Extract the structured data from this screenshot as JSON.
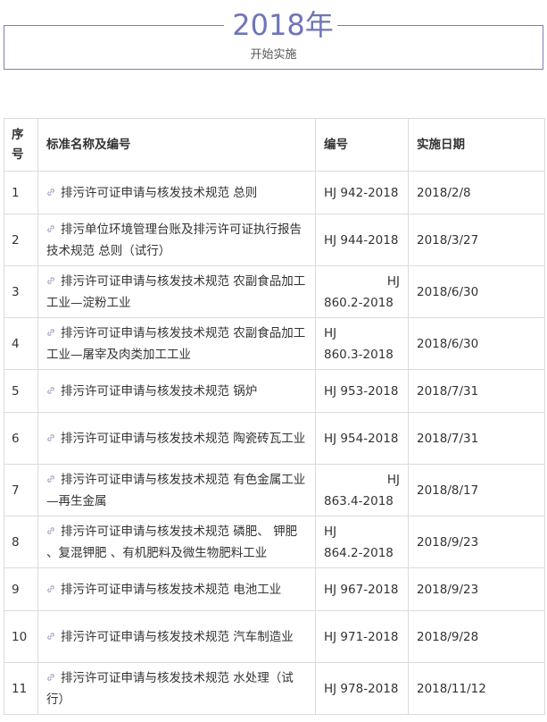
{
  "header": {
    "year": "2018年",
    "subtitle": "开始实施"
  },
  "table": {
    "columns": [
      "序号",
      "标准名称及编号",
      "编号",
      "实施日期"
    ],
    "rows": [
      {
        "idx": "1",
        "name": "排污许可证申请与核发技术规范 总则",
        "code": "HJ 942-2018",
        "date": "2018/2/8"
      },
      {
        "idx": "2",
        "name": "排污单位环境管理台账及排污许可证执行报告技术规范 总则（试行）",
        "code": "HJ 944-2018",
        "date": "2018/3/27"
      },
      {
        "idx": "3",
        "name": "排污许可证申请与核发技术规范 农副食品加工工业—淀粉工业",
        "code": "HJ 860.2-2018",
        "date": "2018/6/30"
      },
      {
        "idx": "4",
        "name": "排污许可证申请与核发技术规范  农副食品加工工业—屠宰及肉类加工工业",
        "code": "HJ 860.3-2018",
        "date": "2018/6/30"
      },
      {
        "idx": "5",
        "name": "排污许可证申请与核发技术规范 锅炉",
        "code": "HJ 953-2018",
        "date": "2018/7/31"
      },
      {
        "idx": "6",
        "name": "排污许可证申请与核发技术规范 陶瓷砖瓦工业",
        "code": "HJ 954-2018",
        "date": "2018/7/31"
      },
      {
        "idx": "7",
        "name": "排污许可证申请与核发技术规范 有色金属工业—再生金属",
        "code": "HJ 863.4-2018",
        "date": "2018/8/17"
      },
      {
        "idx": "8",
        "name": "排污许可证申请与核发技术规范 磷肥、 钾肥 、复混钾肥 、有机肥料及微生物肥料工业",
        "code": "HJ 864.2-2018",
        "date": "2018/9/23"
      },
      {
        "idx": "9",
        "name": "排污许可证申请与核发技术规范 电池工业",
        "code": "HJ 967-2018",
        "date": "2018/9/23"
      },
      {
        "idx": "10",
        "name": "排污许可证申请与核发技术规范 汽车制造业",
        "code": "HJ 971-2018",
        "date": "2018/9/28"
      },
      {
        "idx": "11",
        "name": "排污许可证申请与核发技术规范 水处理（试行）",
        "code": "HJ 978-2018",
        "date": "2018/11/12"
      }
    ]
  },
  "colors": {
    "accent": "#6f75b7",
    "border": "#dcdcdc",
    "link_icon": "#a8a8c8"
  },
  "icons": {
    "row_link": "link-icon"
  }
}
